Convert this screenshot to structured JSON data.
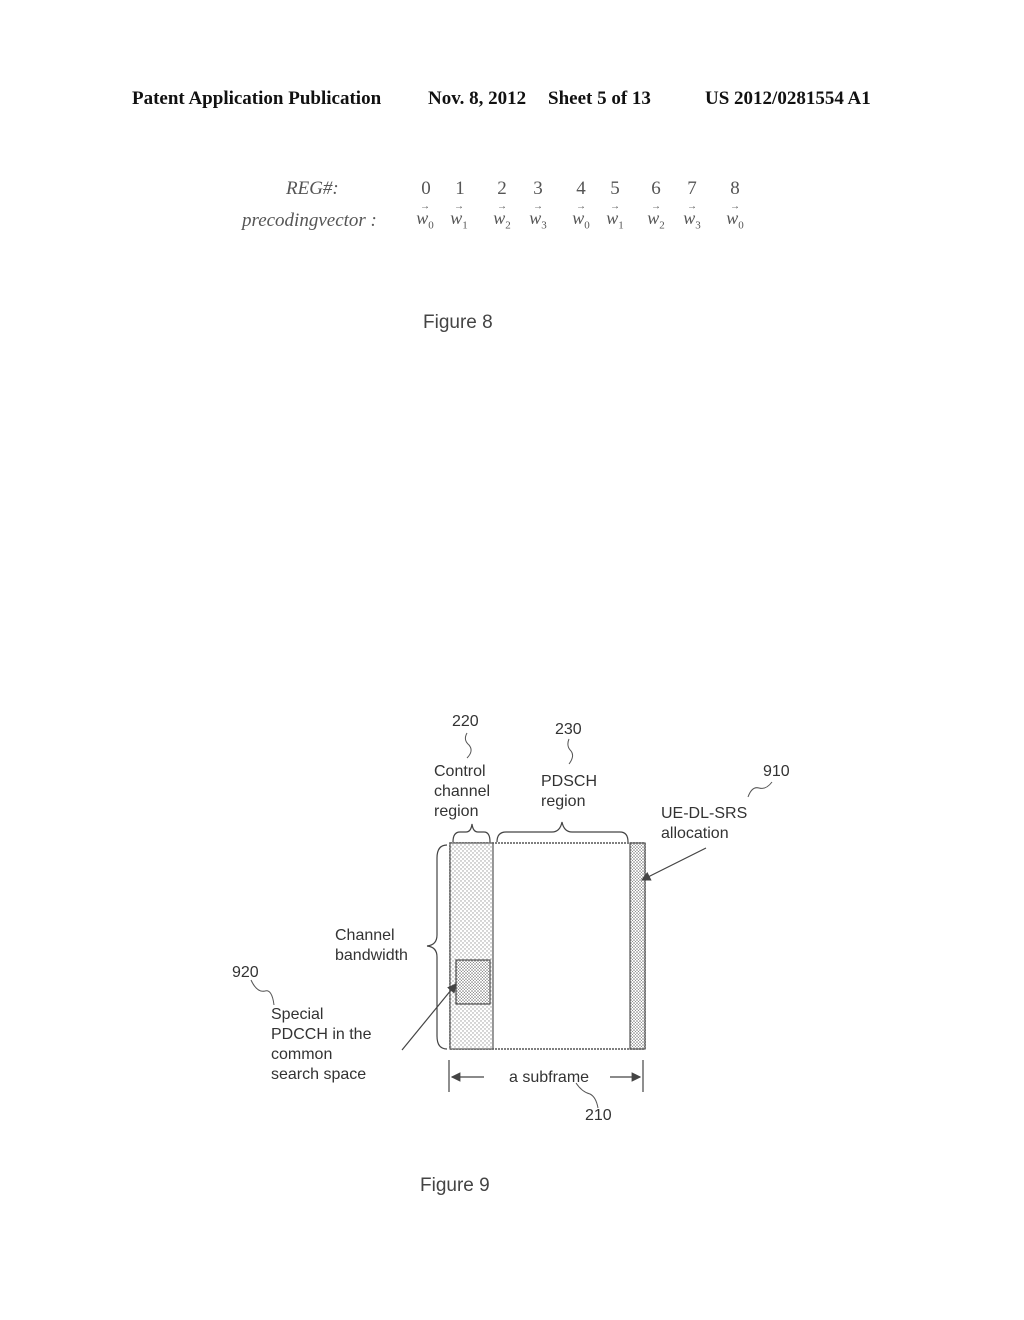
{
  "header": {
    "publication": "Patent Application Publication",
    "date": "Nov. 8, 2012",
    "sheet": "Sheet 5 of 13",
    "number": "US 2012/0281554 A1"
  },
  "figure8": {
    "reg_label": "REG#:",
    "vector_label": "precodingvector :",
    "reg_numbers": [
      "0",
      "1",
      "2",
      "3",
      "4",
      "5",
      "6",
      "7",
      "8"
    ],
    "vectors": [
      {
        "sym": "w",
        "sub": "0"
      },
      {
        "sym": "w",
        "sub": "1"
      },
      {
        "sym": "w",
        "sub": "2"
      },
      {
        "sym": "w",
        "sub": "3"
      },
      {
        "sym": "w",
        "sub": "0"
      },
      {
        "sym": "w",
        "sub": "1"
      },
      {
        "sym": "w",
        "sub": "2"
      },
      {
        "sym": "w",
        "sub": "3"
      },
      {
        "sym": "w",
        "sub": "0"
      }
    ],
    "caption": "Figure 8"
  },
  "figure9": {
    "ref_220": "220",
    "control_region": [
      "Control",
      "channel",
      "region"
    ],
    "ref_230": "230",
    "pdsch_region": [
      "PDSCH",
      "region"
    ],
    "ref_910": "910",
    "srs_allocation": [
      "UE-DL-SRS",
      "allocation"
    ],
    "channel_bandwidth": [
      "Channel",
      "bandwidth"
    ],
    "ref_920": "920",
    "special_pdcch": [
      "Special",
      "PDCCH in the",
      "common",
      "search space"
    ],
    "subframe": "a subframe",
    "ref_210": "210",
    "caption": "Figure 9"
  }
}
